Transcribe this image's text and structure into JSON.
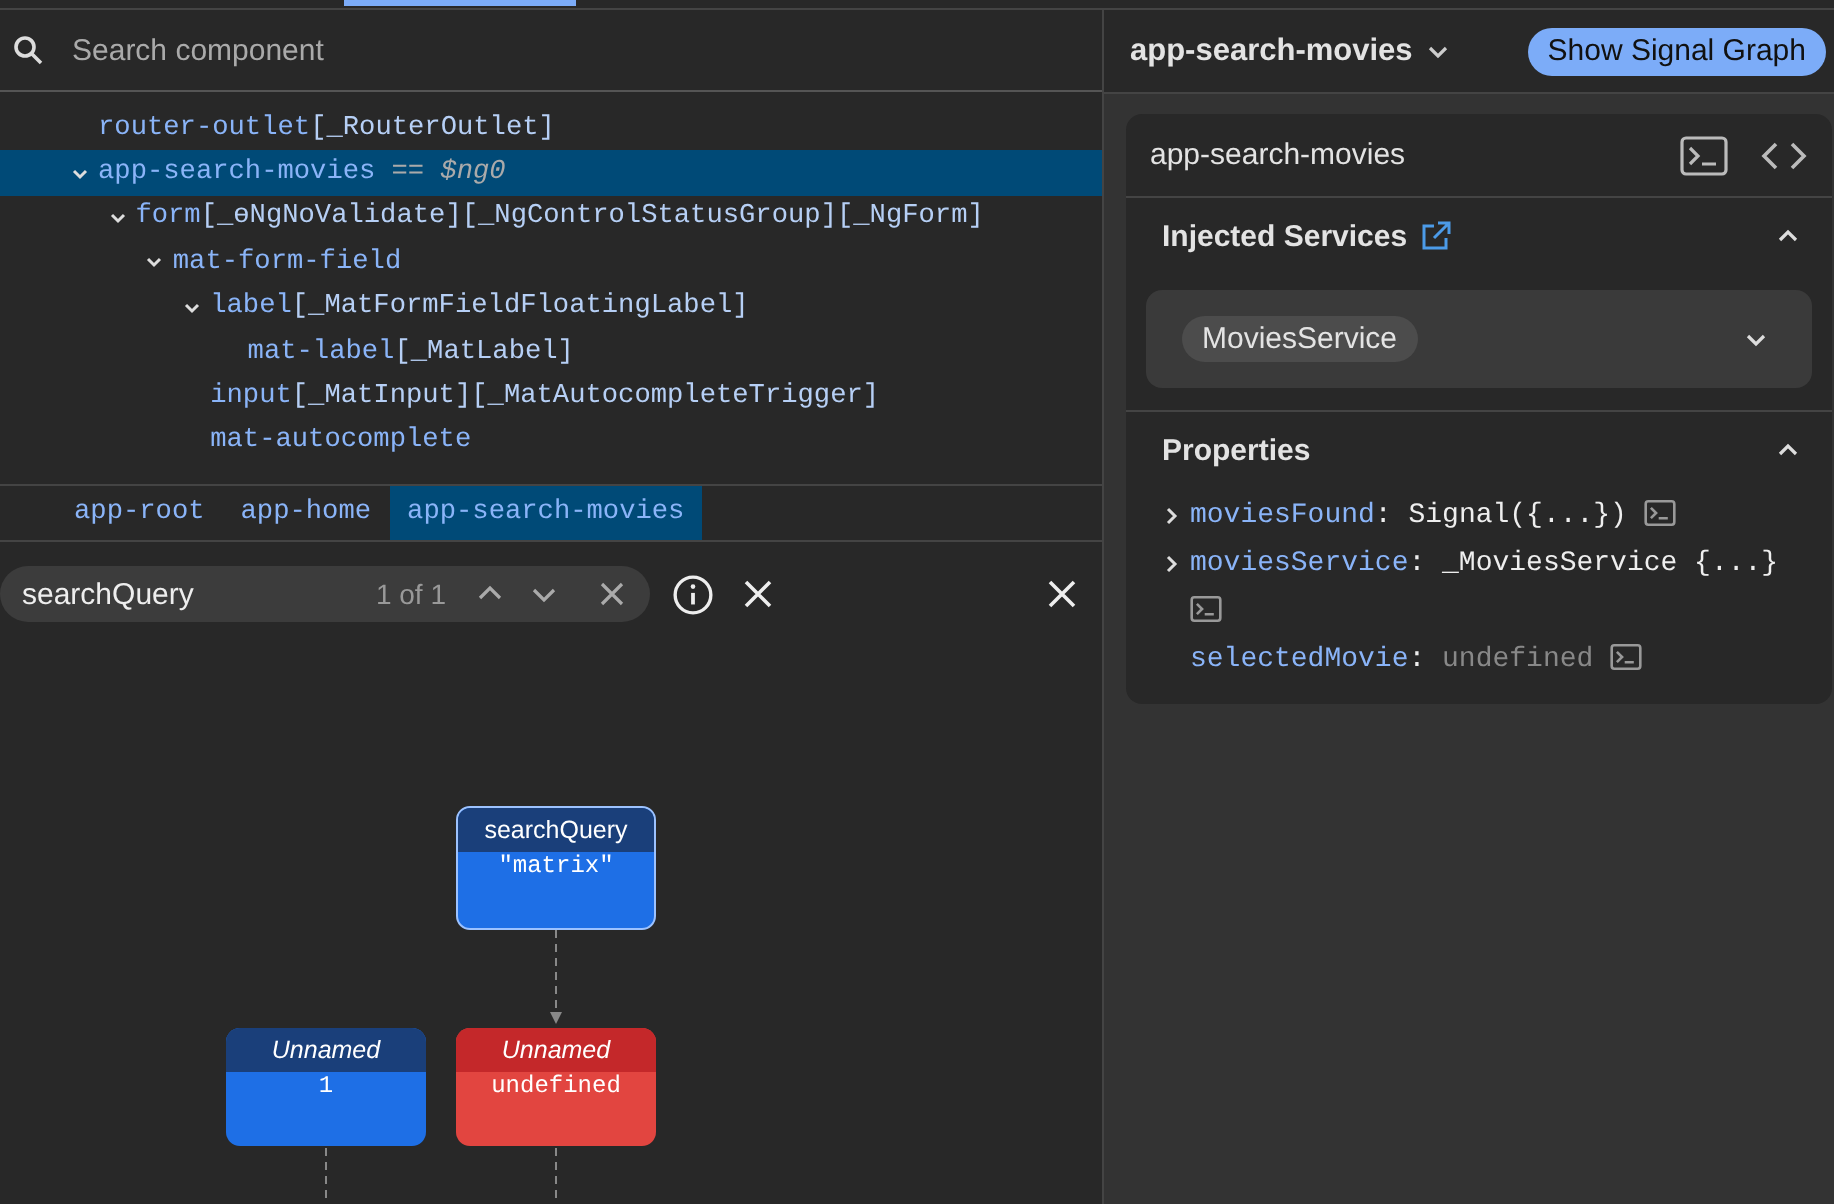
{
  "component_search": {
    "placeholder": "Search component"
  },
  "component_tree": [
    {
      "name": "router-outlet",
      "directives": "[_RouterOutlet]",
      "selected": false
    },
    {
      "name": "app-search-movies",
      "reference": "== *$ng0*",
      "selected": true,
      "expanded": true,
      "children": [
        {
          "name": "form",
          "directives": "[_ɵNgNoValidate][_NgControlStatusGroup][_NgForm]",
          "selected": false,
          "expanded": true,
          "children": [
            {
              "name": "mat-form-field",
              "selected": false,
              "expanded": true,
              "children": [
                {
                  "name": "label",
                  "directives": "[_MatFormFieldFloatingLabel]",
                  "selected": false,
                  "expanded": true,
                  "children": [
                    {
                      "name": "mat-label",
                      "directives": "[_MatLabel]",
                      "selected": false
                    }
                  ]
                },
                {
                  "name": "input",
                  "directives": "[_MatInput][_MatAutocompleteTrigger]",
                  "selected": false
                },
                {
                  "name": "mat-autocomplete",
                  "selected": false
                }
              ]
            }
          ]
        }
      ]
    }
  ],
  "breadcrumbs": [
    {
      "label": "app-root",
      "selected": false
    },
    {
      "label": "app-home",
      "selected": false
    },
    {
      "label": "app-search-movies",
      "selected": true
    }
  ],
  "signal_graph": {
    "search": {
      "value": "searchQuery",
      "match_count": "1 of 1"
    },
    "nodes": [
      {
        "kind": "signal",
        "name": "searchQuery",
        "value": "\"matrix\""
      },
      {
        "kind": "signal",
        "name": "Unnamed",
        "value": "1"
      },
      {
        "kind": "error",
        "name": "Unnamed",
        "value": "undefined"
      }
    ]
  },
  "details": {
    "component": "app-search-movies",
    "button": "Show Signal Graph",
    "card_title": "app-search-movies",
    "injected_services": {
      "title": "Injected Services",
      "expanded": true,
      "services": [
        "MoviesService"
      ]
    },
    "properties": {
      "title": "Properties",
      "expanded": true,
      "separator": ":",
      "items": [
        {
          "name": "moviesFound",
          "value": "Signal({...})",
          "kind": "object",
          "expandable": true
        },
        {
          "name": "moviesService",
          "value": "_MoviesService {...}",
          "kind": "object",
          "expandable": true
        },
        {
          "name": "selectedMovie",
          "value": "undefined",
          "kind": "undefined",
          "expandable": false
        }
      ]
    }
  }
}
